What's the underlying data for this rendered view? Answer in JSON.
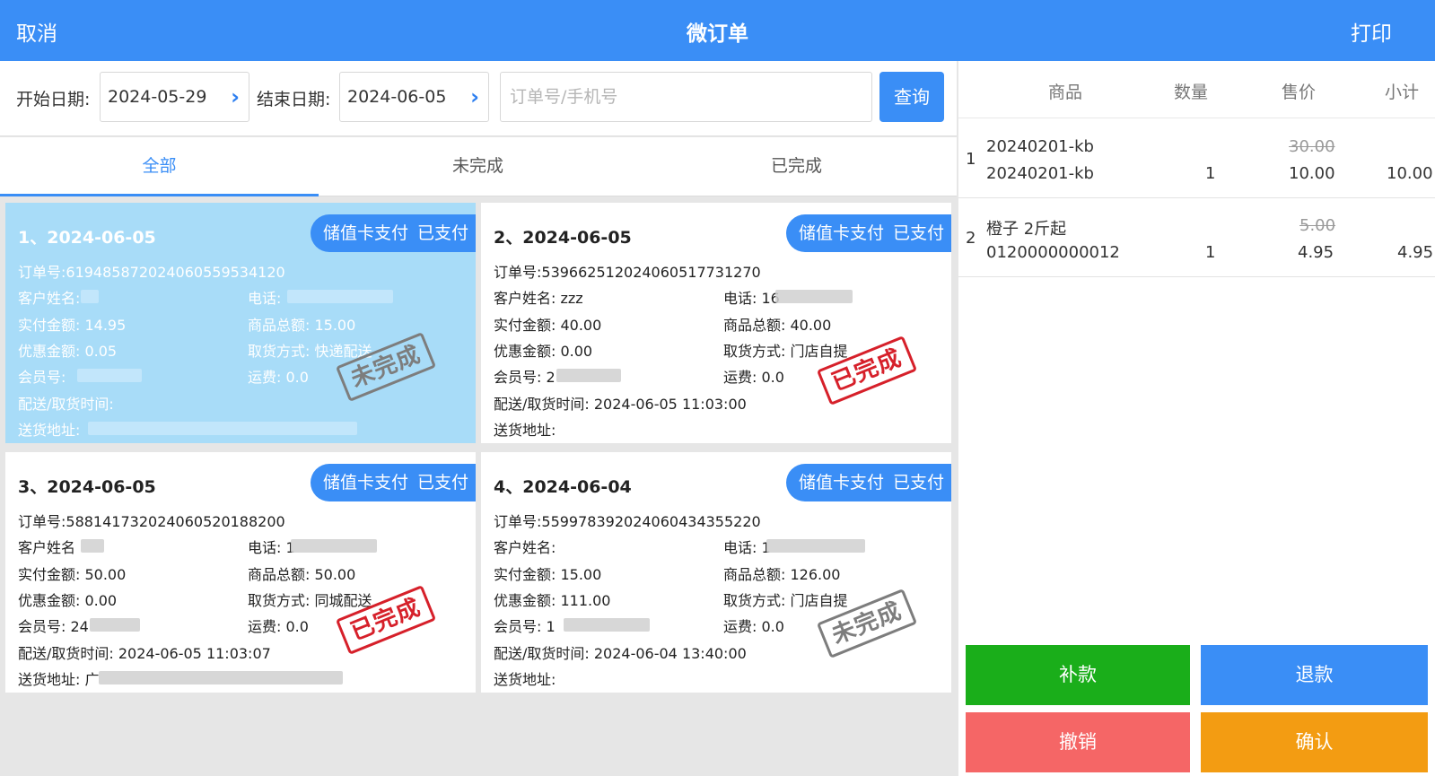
{
  "header": {
    "cancel": "取消",
    "title": "微订单",
    "print": "打印"
  },
  "filter": {
    "start_label": "开始日期:",
    "start_value": "2024-05-29",
    "end_label": "结束日期:",
    "end_value": "2024-06-05",
    "search_placeholder": "订单号/手机号",
    "query": "查询"
  },
  "tabs": [
    "全部",
    "未完成",
    "已完成"
  ],
  "orders": [
    {
      "title": "1、2024-06-05",
      "pay_method": "储值卡支付",
      "pay_status": "已支付",
      "order_no": "订单号:619485872024060559534120",
      "customer": "客户姓名:",
      "phone": "电话:",
      "paid": "实付金额: 14.95",
      "total": "商品总额: 15.00",
      "discount": "优惠金额: 0.05",
      "pickup": "取货方式: 快递配送",
      "member": "会员号:",
      "freight": "运费: 0.0",
      "delivery_time": "配送/取货时间:",
      "address": "送货地址:",
      "stamp": "未完成"
    },
    {
      "title": "2、2024-06-05",
      "pay_method": "储值卡支付",
      "pay_status": "已支付",
      "order_no": "订单号:539662512024060517731270",
      "customer": "客户姓名: zzz",
      "phone": "电话: 16",
      "paid": "实付金额: 40.00",
      "total": "商品总额: 40.00",
      "discount": "优惠金额: 0.00",
      "pickup": "取货方式: 门店自提",
      "member": "会员号: 2",
      "freight": "运费: 0.0",
      "delivery_time": "配送/取货时间: 2024-06-05 11:03:00",
      "address": "送货地址:",
      "stamp": "已完成"
    },
    {
      "title": "3、2024-06-05",
      "pay_method": "储值卡支付",
      "pay_status": "已支付",
      "order_no": "订单号:588141732024060520188200",
      "customer": "客户姓名",
      "phone": "电话: 1",
      "paid": "实付金额: 50.00",
      "total": "商品总额: 50.00",
      "discount": "优惠金额: 0.00",
      "pickup": "取货方式: 同城配送",
      "member": "会员号: 24",
      "freight": "运费: 0.0",
      "delivery_time": "配送/取货时间: 2024-06-05 11:03:07",
      "address": "送货地址: 广",
      "stamp": "已完成"
    },
    {
      "title": "4、2024-06-04",
      "pay_method": "储值卡支付",
      "pay_status": "已支付",
      "order_no": "订单号:559978392024060434355220",
      "customer": "客户姓名:",
      "phone": "电话: 1",
      "paid": "实付金额: 15.00",
      "total": "商品总额: 126.00",
      "discount": "优惠金额: 111.00",
      "pickup": "取货方式: 门店自提",
      "member": "会员号: 1",
      "freight": "运费: 0.0",
      "delivery_time": "配送/取货时间: 2024-06-04 13:40:00",
      "address": "送货地址:",
      "stamp": "未完成"
    }
  ],
  "detail": {
    "columns": [
      "商品",
      "数量",
      "售价",
      "小计"
    ],
    "items": [
      {
        "index": "1",
        "name": "20240201-kb",
        "code": "20240201-kb",
        "qty": "1",
        "orig_price": "30.00",
        "price": "10.00",
        "subtotal": "10.00"
      },
      {
        "index": "2",
        "name": "橙子 2斤起",
        "code": "0120000000012",
        "qty": "1",
        "orig_price": "5.00",
        "price": "4.95",
        "subtotal": "4.95"
      }
    ]
  },
  "actions": {
    "supplement": "补款",
    "refund": "退款",
    "revoke": "撤销",
    "confirm": "确认",
    "colors": {
      "supplement": "#1aae1a",
      "refund": "#3a8ef6",
      "revoke": "#f56666",
      "confirm": "#f39c12"
    }
  }
}
